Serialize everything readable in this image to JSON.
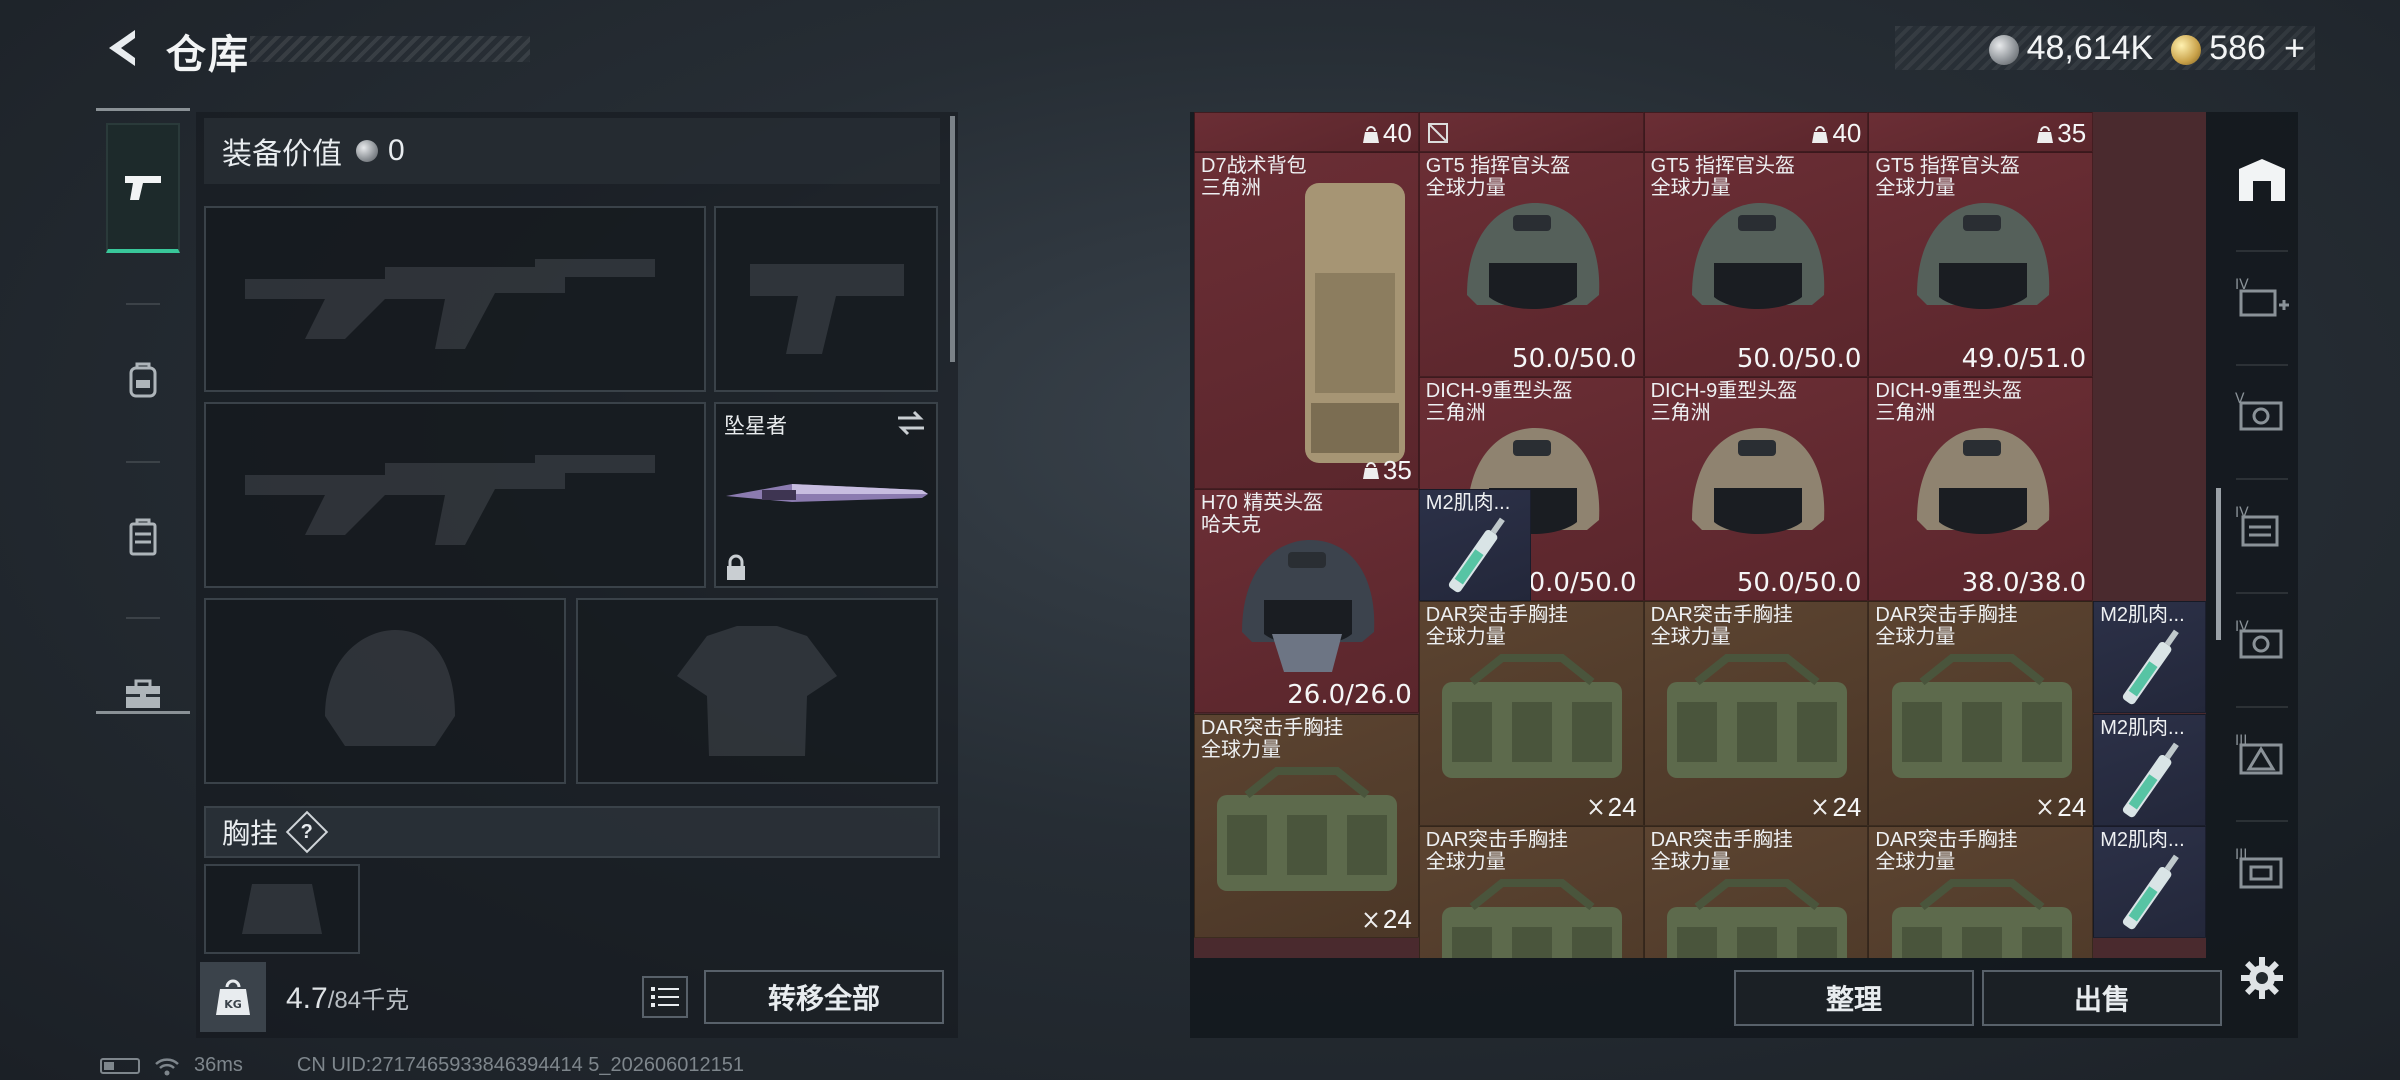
{
  "header": {
    "title": "仓库",
    "silver": "48,614K",
    "gold": "586",
    "plus": "+"
  },
  "left": {
    "value_label": "装备价值",
    "value": "0",
    "melee_name": "坠星者",
    "chest_label": "胸挂",
    "help": "?",
    "weight_current": "4.7",
    "weight_max": "/84千克",
    "transfer_all": "转移全部"
  },
  "status": {
    "ping": "36ms",
    "uid": "CN UID:2717465933846394414 5_202606012151"
  },
  "grid": {
    "top_counts": [
      "40",
      "40",
      "35"
    ],
    "items": [
      {
        "name": "D7战术背包\n三角洲",
        "count": "35",
        "color": "red"
      },
      {
        "name": "GT5 指挥官头盔\n全球力量",
        "durability": "50.0/50.0",
        "color": "red"
      },
      {
        "name": "GT5 指挥官头盔\n全球力量",
        "durability": "50.0/50.0",
        "color": "red"
      },
      {
        "name": "GT5 指挥官头盔\n全球力量",
        "durability": "49.0/51.0",
        "color": "red"
      },
      {
        "name": "DICH-9重型头盔\n三角洲",
        "durability": "50.0/50.0",
        "color": "red"
      },
      {
        "name": "DICH-9重型头盔\n三角洲",
        "durability": "50.0/50.0",
        "color": "red"
      },
      {
        "name": "DICH-9重型头盔\n三角洲",
        "durability": "38.0/38.0",
        "color": "red"
      },
      {
        "name": "H70 精英头盔\n哈夫克",
        "durability": "26.0/26.0",
        "color": "red"
      },
      {
        "name": "M2肌肉...",
        "color": "blue"
      },
      {
        "name": "DAR突击手胸挂\n全球力量",
        "count": "24",
        "color": "brown"
      },
      {
        "name": "DAR突击手胸挂\n全球力量",
        "count": "24",
        "color": "brown"
      },
      {
        "name": "DAR突击手胸挂\n全球力量",
        "count": "24",
        "color": "brown"
      },
      {
        "name": "M2肌肉...",
        "color": "blue"
      },
      {
        "name": "DAR突击手胸挂\n全球力量",
        "count": "24",
        "color": "brown"
      },
      {
        "name": "M2肌肉...",
        "color": "blue"
      },
      {
        "name": "DAR突击手胸挂\n全球力量",
        "color": "brown"
      },
      {
        "name": "DAR突击手胸挂\n全球力量",
        "color": "brown"
      },
      {
        "name": "DAR突击手胸挂\n全球力量",
        "color": "brown"
      },
      {
        "name": "M2肌肉...",
        "color": "blue"
      }
    ]
  },
  "buttons": {
    "sort": "整理",
    "sell": "出售"
  },
  "colors": {
    "accent": "#39c79a",
    "rarity_red": "#6b2e35",
    "rarity_brown": "#5c4431",
    "rarity_blue": "#2c3148"
  },
  "icons": [
    "back-arrow-icon",
    "pistol-icon",
    "backpack-icon",
    "vest-icon",
    "toolbox-icon",
    "kg-weight-icon",
    "list-icon",
    "swap-icon",
    "lock-icon",
    "settings-gear-icon",
    "safe-house-icon"
  ]
}
